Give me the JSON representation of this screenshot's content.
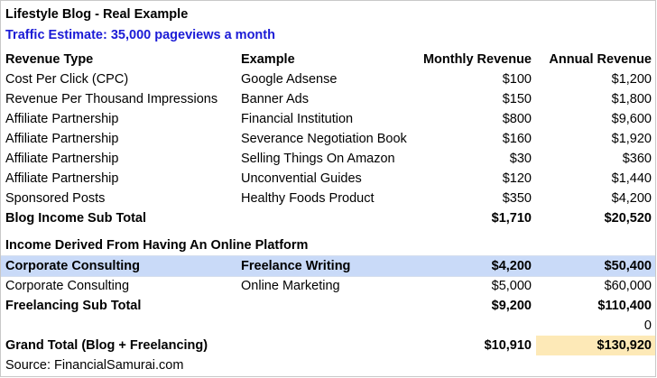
{
  "title": "Lifestyle Blog - Real Example",
  "traffic": "Traffic Estimate: 35,000 pageviews a month",
  "headers": {
    "type": "Revenue Type",
    "example": "Example",
    "monthly": "Monthly Revenue",
    "annual": "Annual Revenue"
  },
  "blog_rows": [
    {
      "type": "Cost Per Click (CPC)",
      "example": "Google Adsense",
      "monthly": "$100",
      "annual": "$1,200"
    },
    {
      "type": "Revenue Per Thousand Impressions",
      "example": "Banner Ads",
      "monthly": "$150",
      "annual": "$1,800"
    },
    {
      "type": "Affiliate Partnership",
      "example": "Financial Institution",
      "monthly": "$800",
      "annual": "$9,600"
    },
    {
      "type": "Affiliate Partnership",
      "example": "Severance Negotiation Book",
      "monthly": "$160",
      "annual": "$1,920"
    },
    {
      "type": "Affiliate Partnership",
      "example": "Selling Things On Amazon",
      "monthly": "$30",
      "annual": "$360"
    },
    {
      "type": "Affiliate Partnership",
      "example": "Unconvential Guides",
      "monthly": "$120",
      "annual": "$1,440"
    },
    {
      "type": "Sponsored Posts",
      "example": "Healthy Foods Product",
      "monthly": "$350",
      "annual": "$4,200"
    }
  ],
  "blog_subtotal": {
    "label": "Blog Income Sub Total",
    "monthly": "$1,710",
    "annual": "$20,520"
  },
  "platform_heading": "Income Derived From Having An Online Platform",
  "freelance_rows": [
    {
      "type": "Corporate Consulting",
      "example": "Freelance Writing",
      "monthly": "$4,200",
      "annual": "$50,400"
    },
    {
      "type": "Corporate Consulting",
      "example": "Online Marketing",
      "monthly": "$5,000",
      "annual": "$60,000"
    }
  ],
  "freelance_subtotal": {
    "label": "Freelancing Sub Total",
    "monthly": "$9,200",
    "annual": "$110,400"
  },
  "zero_value": "0",
  "grand_total": {
    "label": "Grand Total (Blog + Freelancing)",
    "monthly": "$10,910",
    "annual": "$130,920"
  },
  "source": "Source: FinancialSamurai.com",
  "colors": {
    "blue_text": "#1b1bd6",
    "highlight_blue": "#c9daf8",
    "highlight_yellow": "#fde9b7"
  }
}
